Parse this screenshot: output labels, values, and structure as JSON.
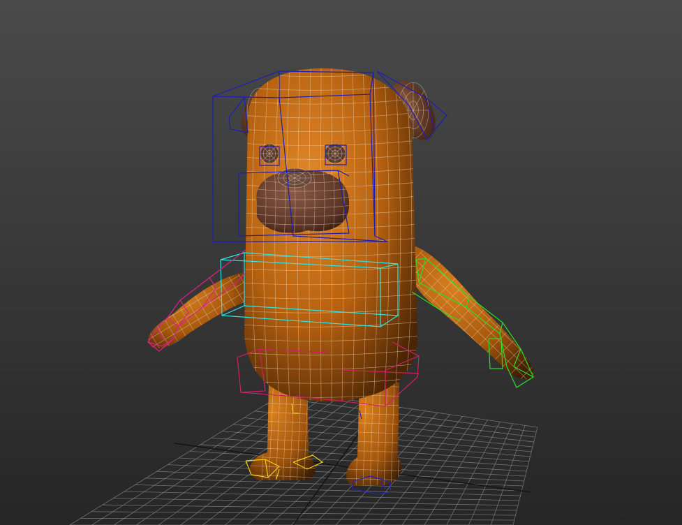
{
  "viewport": {
    "background_top": "#4a4a4a",
    "background_bottom": "#262626"
  },
  "colors": {
    "grid": "#8a8a8a",
    "grid_axis": "#151515",
    "body_fill": "#b5600f",
    "body_shadow": "#4a2404",
    "body_highlight": "#e28a2a",
    "wire": "#f0d8b8",
    "nose": "#6a4a3e",
    "snout": "#6b4233",
    "bone_head": "#1e1eb4",
    "bone_spine": "#2ee6e6",
    "bone_left_arm": "#e0208a",
    "bone_right_arm": "#27e027",
    "bone_pelvis": "#d01f6a",
    "bone_foot": "#f2d21a"
  },
  "scene": {
    "object": "cartoon-dog-character",
    "mode": "shaded-wireframe",
    "rig": "biped"
  }
}
